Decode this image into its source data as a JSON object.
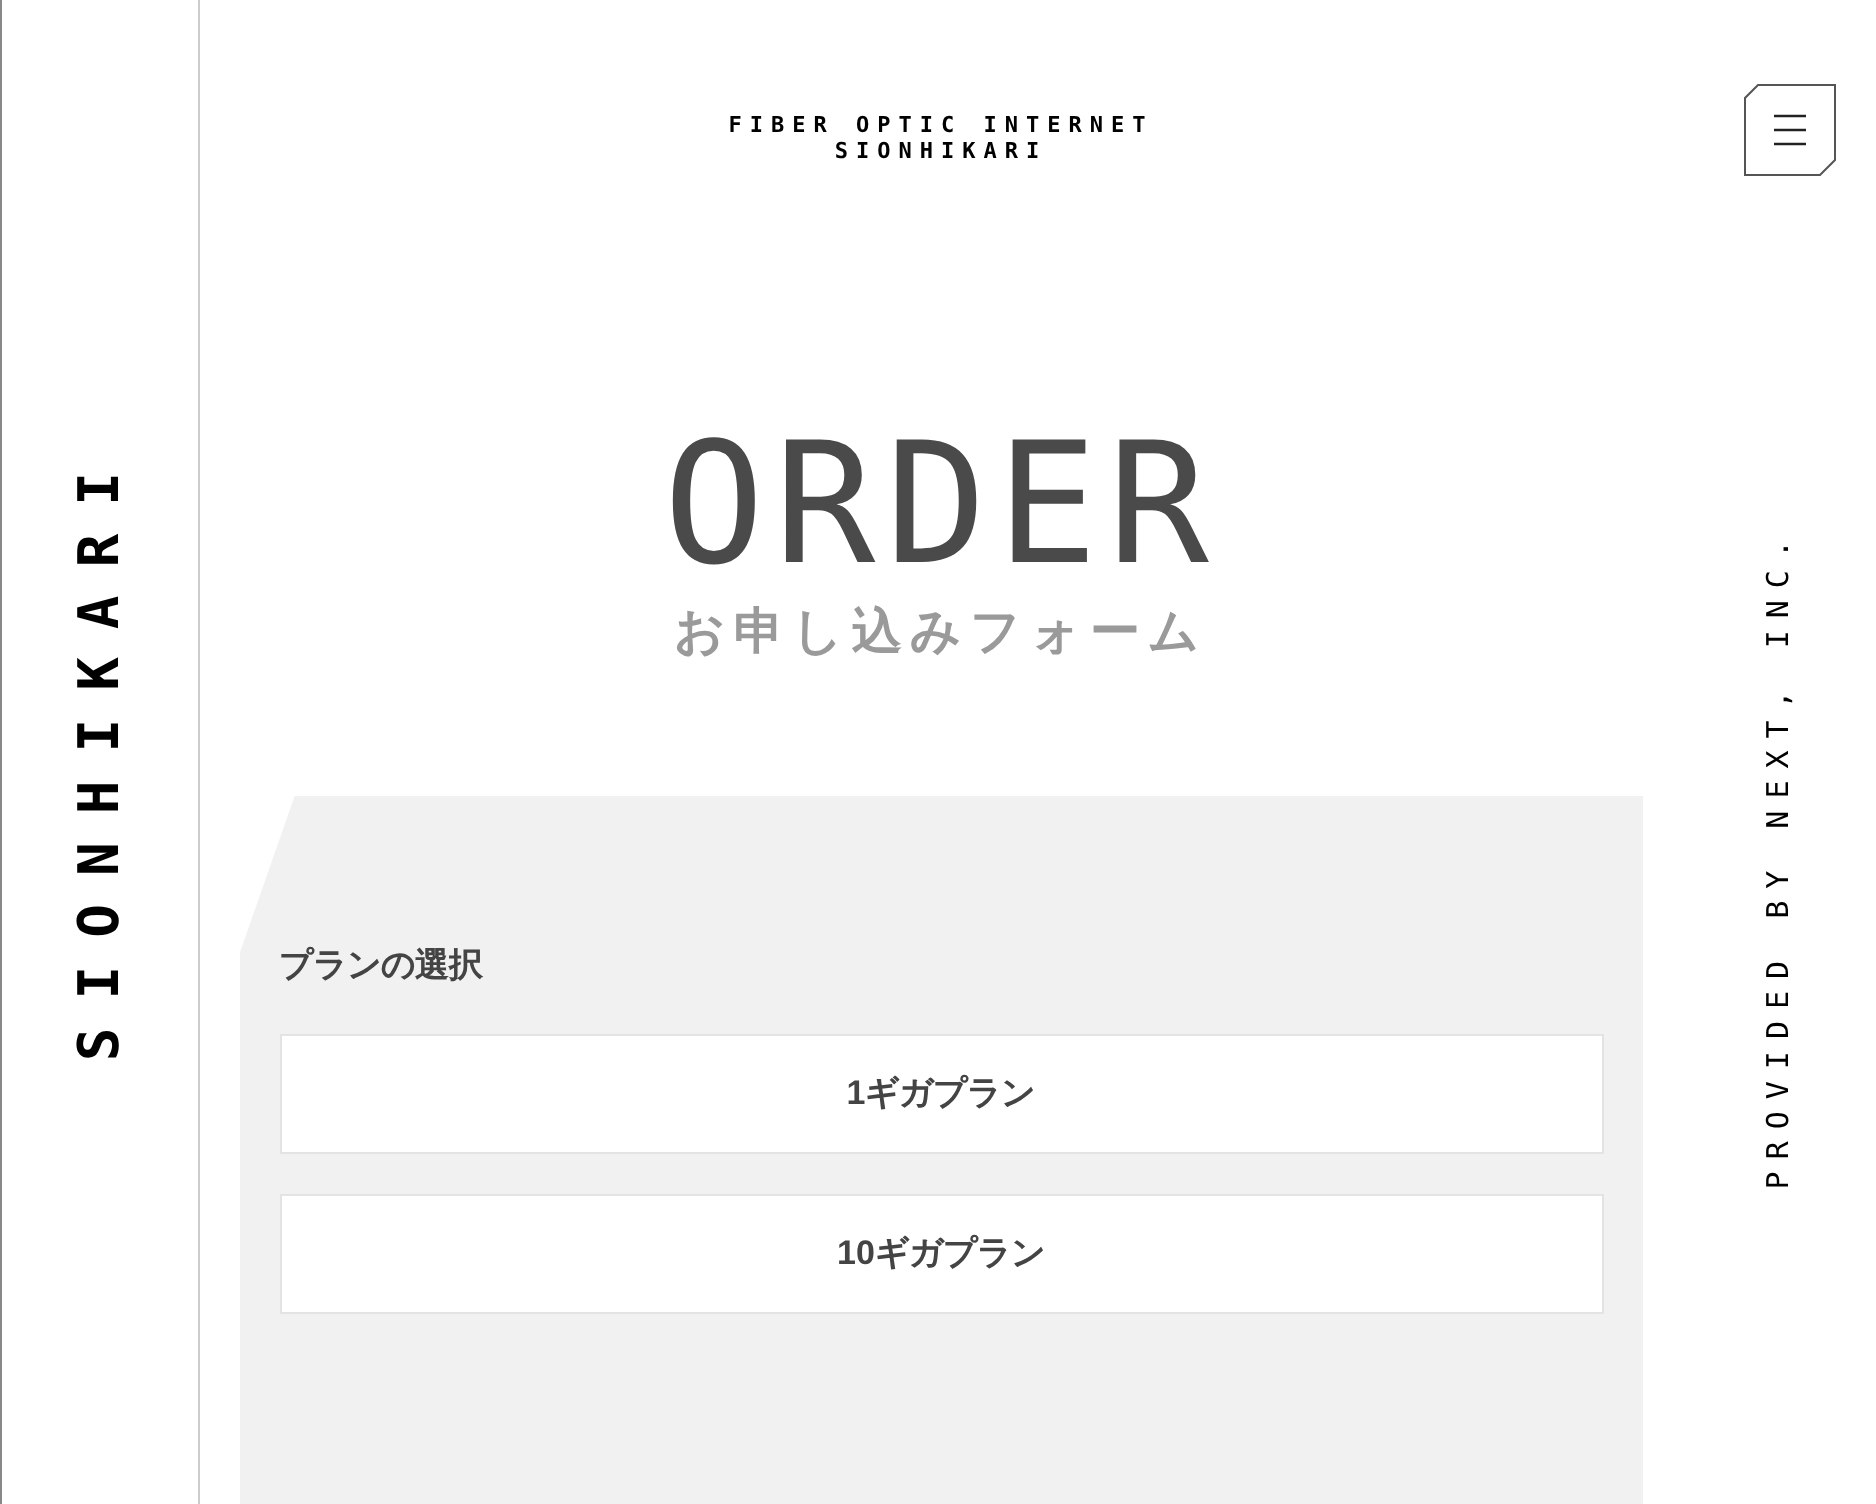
{
  "side_logo": "SIONHIKARI",
  "header": {
    "line_1": "FIBER OPTIC INTERNET",
    "line_2": "SIONHIKARI"
  },
  "hero": {
    "title": "ORDER",
    "subtitle": "お申し込みフォーム"
  },
  "form": {
    "section_title": "プランの選択",
    "plans": [
      {
        "label": "1ギガプラン"
      },
      {
        "label": "10ギガプラン"
      }
    ]
  },
  "credit": "PROVIDED BY NEXT, INC."
}
